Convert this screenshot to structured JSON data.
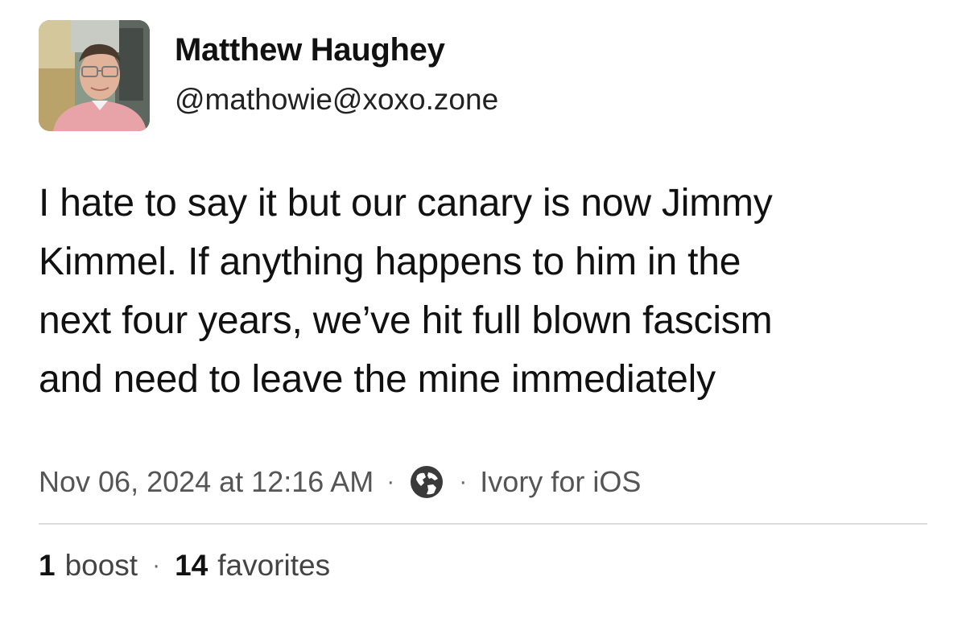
{
  "author": {
    "display_name": "Matthew Haughey",
    "handle": "@mathowie@xoxo.zone",
    "avatar_icon": "profile-photo"
  },
  "post": {
    "text": "I hate to say it but our canary is now Jimmy\nKimmel. If anything happens to him in the\nnext four years, we’ve hit full blown fascism\nand need to leave the mine immediately"
  },
  "meta": {
    "timestamp": "Nov 06, 2024 at 12:16 AM",
    "separator": "·",
    "visibility_icon": "globe-icon",
    "client": "Ivory for iOS"
  },
  "stats": {
    "boosts_count": "1",
    "boosts_label": "boost",
    "favorites_count": "14",
    "favorites_label": "favorites",
    "separator": "·"
  },
  "colors": {
    "text_primary": "#111111",
    "text_secondary": "#555555",
    "divider": "#dcdcdc",
    "background": "#ffffff"
  }
}
